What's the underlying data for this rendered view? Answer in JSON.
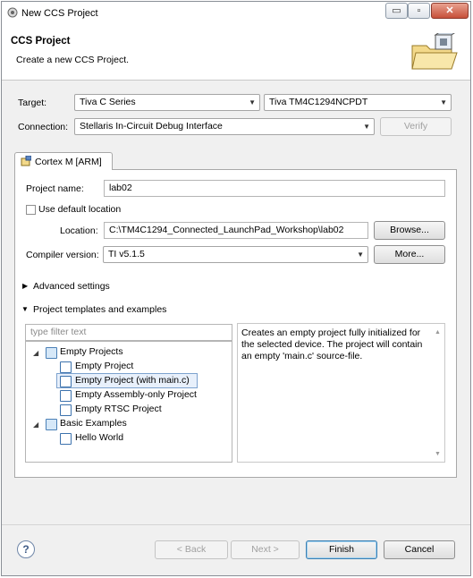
{
  "window": {
    "title": "New CCS Project"
  },
  "title_buttons": {
    "minimize": "▭",
    "maximize": "▫",
    "close": "✕"
  },
  "header": {
    "title": "CCS Project",
    "subtitle": "Create a new CCS Project."
  },
  "target": {
    "label": "Target:",
    "family": "Tiva C Series",
    "device": "Tiva TM4C1294NCPDT"
  },
  "connection": {
    "label": "Connection:",
    "value": "Stellaris In-Circuit Debug Interface",
    "verify_label": "Verify"
  },
  "tab": {
    "label": "Cortex M [ARM]"
  },
  "project": {
    "name_label": "Project name:",
    "name_value": "lab02",
    "use_default_label": "Use default location",
    "use_default_checked": false,
    "location_label": "Location:",
    "location_value": "C:\\TM4C1294_Connected_LaunchPad_Workshop\\lab02",
    "browse_label": "Browse...",
    "compiler_label": "Compiler version:",
    "compiler_value": "TI v5.1.5",
    "more_label": "More..."
  },
  "sections": {
    "advanced": "Advanced settings",
    "templates": "Project templates and examples"
  },
  "filter": {
    "placeholder": "type filter text"
  },
  "tree": {
    "empty_projects": "Empty Projects",
    "empty_project": "Empty Project",
    "empty_project_main": "Empty Project (with main.c)",
    "empty_assembly": "Empty Assembly-only Project",
    "empty_rtsc": "Empty RTSC Project",
    "basic_examples": "Basic Examples",
    "hello_world": "Hello World"
  },
  "description": {
    "line1": "Creates an empty project fully initialized for",
    "line2": "the selected device. The project will contain",
    "line3": "an empty 'main.c' source-file."
  },
  "footer": {
    "help": "?",
    "back": "< Back",
    "next": "Next >",
    "finish": "Finish",
    "cancel": "Cancel"
  },
  "colors": {
    "accent": "#3c7fb1",
    "selection": "#e8f0fb"
  }
}
